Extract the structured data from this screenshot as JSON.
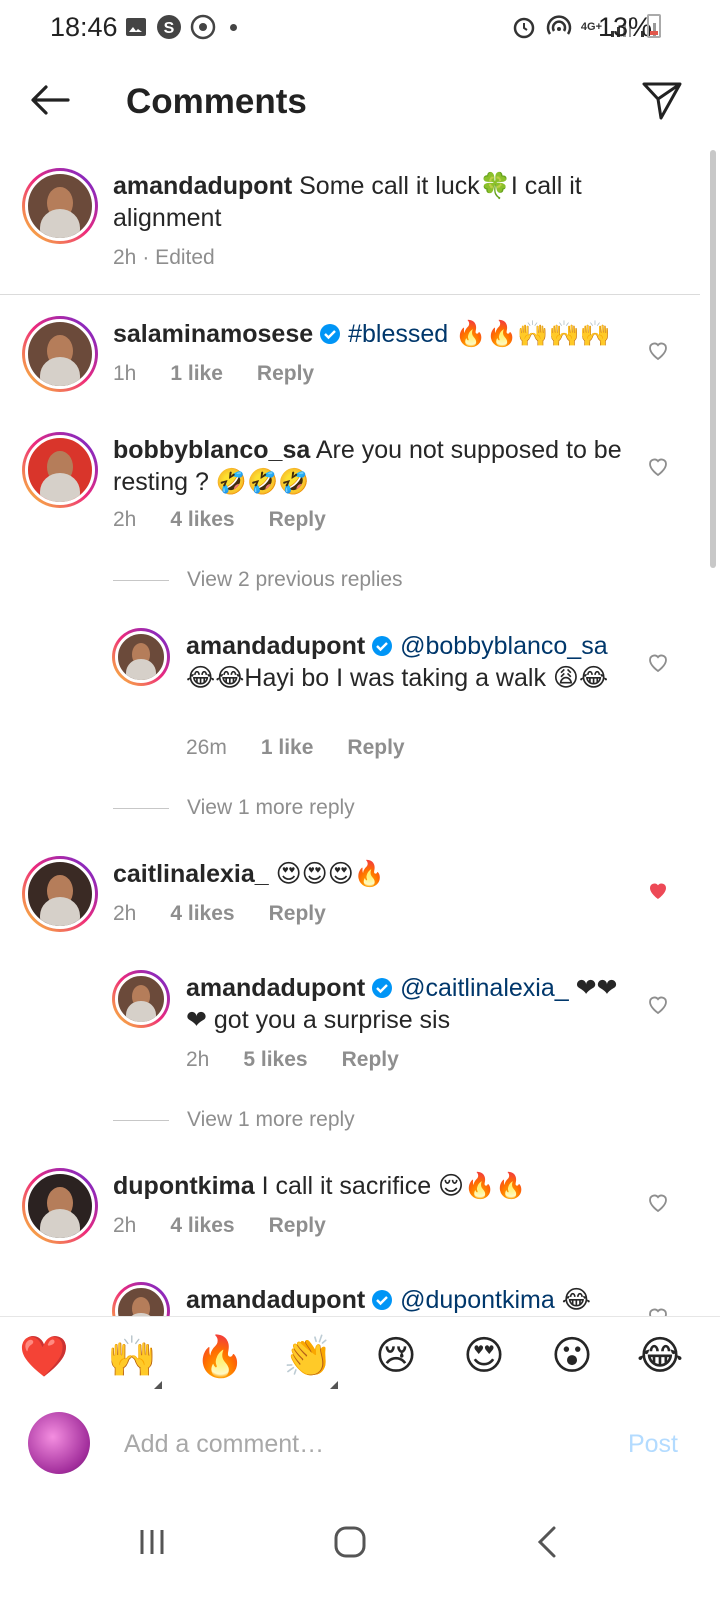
{
  "status_bar": {
    "time": "18:46",
    "network": "4G+",
    "battery": "13%"
  },
  "header": {
    "title": "Comments"
  },
  "caption": {
    "username": "amandadupont",
    "text": "Some call it luck🍀I call it alignment",
    "time": "2h",
    "edited": "· Edited"
  },
  "comments": [
    {
      "username": "salaminamosese",
      "verified": true,
      "hashtag": "#blessed",
      "text": " 🔥🔥🙌🙌🙌",
      "time": "1h",
      "likes": "1 like",
      "reply": "Reply",
      "liked": false
    },
    {
      "username": "bobbyblanco_sa",
      "text": "Are you not supposed to be resting ? 🤣🤣🤣",
      "time": "2h",
      "likes": "4 likes",
      "reply": "Reply",
      "liked": false
    },
    {
      "view_replies": "View 2 previous replies"
    },
    {
      "username": "amandadupont",
      "verified": true,
      "mention": "@bobbyblanco_sa",
      "text": "😂😂Hayi bo I was taking a walk 😩😂",
      "time": "26m",
      "likes": "1 like",
      "reply": "Reply",
      "liked": false
    },
    {
      "view_replies": "View 1 more reply"
    },
    {
      "username": "caitlinalexia_",
      "text": "😍😍😍🔥",
      "time": "2h",
      "likes": "4 likes",
      "reply": "Reply",
      "liked": true
    },
    {
      "username": "amandadupont",
      "verified": true,
      "mention": "@caitlinalexia_",
      "text": " ❤❤❤ got you a surprise sis",
      "time": "2h",
      "likes": "5 likes",
      "reply": "Reply",
      "liked": false
    },
    {
      "view_replies": "View 1 more reply"
    },
    {
      "username": "dupontkima",
      "text": "I call it sacrifice 😌🔥🔥",
      "time": "2h",
      "likes": "4 likes",
      "reply": "Reply",
      "liked": false
    },
    {
      "username": "amandadupont",
      "verified": true,
      "mention": "@dupontkima",
      "text": " 😂"
    }
  ],
  "emoji_bar": [
    "❤️",
    "🙌",
    "🔥",
    "👏",
    "😢",
    "😍",
    "😮",
    "😂"
  ],
  "compose": {
    "placeholder": "Add a comment…",
    "post_label": "Post"
  },
  "colors": {
    "accent_link": "#00376b",
    "liked_heart": "#ed4956",
    "post_disabled": "#b3dbff",
    "verified": "#0095f6"
  }
}
